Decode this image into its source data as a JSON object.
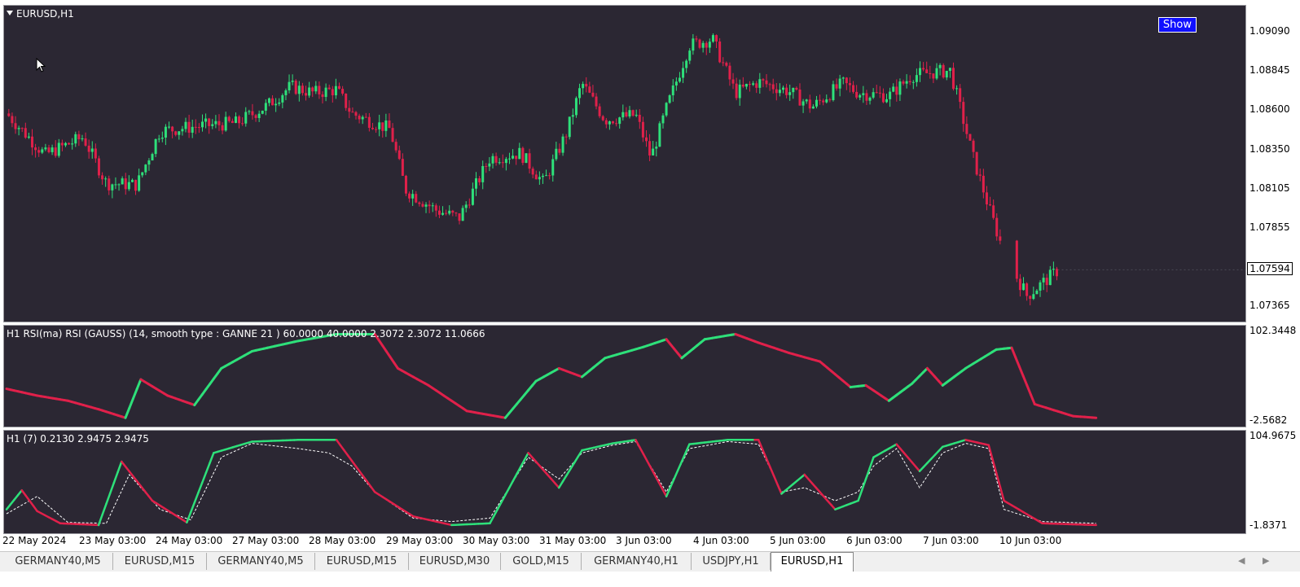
{
  "main": {
    "title": "EURUSD,H1",
    "show_button": "Show",
    "price_ticks": [
      "1.09090",
      "1.08845",
      "1.08600",
      "1.08350",
      "1.08105",
      "1.07855",
      "1.07365"
    ],
    "current_price": "1.07594",
    "colors": {
      "background": "#2b2733",
      "bull": "#2ee07a",
      "bear": "#e0204a"
    }
  },
  "rsi_pane": {
    "title": "H1 RSI(ma) RSI (GAUSS) (14, smooth type : GANNE  21 ) 60.0000 40.0000 2.3072 2.3072 11.0666",
    "ticks": [
      "102.3448",
      "-2.5682"
    ],
    "level_hint": "0.00"
  },
  "osc_pane": {
    "title": "H1  (7) 0.2130 2.9475 2.9475",
    "ticks": [
      "104.9675",
      "-1.8371"
    ],
    "level_hint": "0.00"
  },
  "time_axis": [
    "22 May 2024",
    "23 May 03:00",
    "24 May 03:00",
    "27 May 03:00",
    "28 May 03:00",
    "29 May 03:00",
    "30 May 03:00",
    "31 May 03:00",
    "3 Jun 03:00",
    "4 Jun 03:00",
    "5 Jun 03:00",
    "6 Jun 03:00",
    "7 Jun 03:00",
    "10 Jun 03:00"
  ],
  "tabs": [
    {
      "label": "GERMANY40,M5",
      "active": false
    },
    {
      "label": "EURUSD,M15",
      "active": false
    },
    {
      "label": "GERMANY40,M5",
      "active": false
    },
    {
      "label": "EURUSD,M15",
      "active": false
    },
    {
      "label": "EURUSD,M30",
      "active": false
    },
    {
      "label": "GOLD,M15",
      "active": false
    },
    {
      "label": "GERMANY40,H1",
      "active": false
    },
    {
      "label": "USDJPY,H1",
      "active": false
    },
    {
      "label": "EURUSD,H1",
      "active": true
    }
  ],
  "chart_data": [
    {
      "type": "candlestick",
      "title": "EURUSD,H1",
      "ylim": [
        1.0725,
        1.0917
      ],
      "x": [
        "22 May 2024",
        "23 May 03:00",
        "24 May 03:00",
        "27 May 03:00",
        "28 May 03:00",
        "29 May 03:00",
        "30 May 03:00",
        "31 May 03:00",
        "3 Jun 03:00",
        "4 Jun 03:00",
        "5 Jun 03:00",
        "6 Jun 03:00",
        "7 Jun 03:00",
        "10 Jun 03:00"
      ],
      "close_path": [
        [
          0,
          1.0858
        ],
        [
          0.5,
          1.0832
        ],
        [
          1,
          1.0843
        ],
        [
          1.3,
          1.0814
        ],
        [
          1.7,
          1.0813
        ],
        [
          2,
          1.0847
        ],
        [
          2.5,
          1.085
        ],
        [
          3,
          1.0852
        ],
        [
          3.4,
          1.0863
        ],
        [
          3.7,
          1.0875
        ],
        [
          4,
          1.0871
        ],
        [
          4.3,
          1.0873
        ],
        [
          4.5,
          1.0858
        ],
        [
          5,
          1.0848
        ],
        [
          5.2,
          1.081
        ],
        [
          5.6,
          1.0797
        ],
        [
          5.9,
          1.0792
        ],
        [
          6.3,
          1.083
        ],
        [
          6.7,
          1.0833
        ],
        [
          7,
          1.0814
        ],
        [
          7.3,
          1.0846
        ],
        [
          7.5,
          1.0877
        ],
        [
          7.8,
          1.0854
        ],
        [
          8.2,
          1.0857
        ],
        [
          8.4,
          1.083
        ],
        [
          8.6,
          1.0861
        ],
        [
          8.9,
          1.0901
        ],
        [
          9.2,
          1.0905
        ],
        [
          9.5,
          1.0871
        ],
        [
          9.8,
          1.0878
        ],
        [
          10.2,
          1.0872
        ],
        [
          10.5,
          1.0862
        ],
        [
          10.9,
          1.0877
        ],
        [
          11.1,
          1.0871
        ],
        [
          11.5,
          1.0869
        ],
        [
          11.8,
          1.0882
        ],
        [
          12.1,
          1.0884
        ],
        [
          12.3,
          1.0885
        ],
        [
          12.6,
          1.083
        ],
        [
          12.8,
          1.0799
        ],
        [
          13.0,
          1.077
        ],
        [
          13.3,
          1.0743
        ],
        [
          13.7,
          1.0759
        ]
      ],
      "last_close": 1.07594
    },
    {
      "type": "line",
      "title": "H1 RSI(ma) RSI (GAUSS) (14, smooth type : GANNE  21 ) 60.0000 40.0000 2.3072 2.3072 11.0666",
      "ylim": [
        -2.5682,
        102.3448
      ],
      "series": [
        {
          "values": [
            [
              0,
              36
            ],
            [
              0.4,
              28
            ],
            [
              0.8,
              22
            ],
            [
              1.2,
              12
            ],
            [
              1.55,
              2
            ],
            [
              1.75,
              47
            ],
            [
              2.1,
              28
            ],
            [
              2.45,
              17
            ],
            [
              2.8,
              60
            ],
            [
              3.2,
              80
            ],
            [
              3.8,
              92
            ],
            [
              4.3,
              100
            ],
            [
              4.8,
              100
            ],
            [
              5.1,
              60
            ],
            [
              5.5,
              40
            ],
            [
              6.0,
              10
            ],
            [
              6.5,
              2
            ],
            [
              6.9,
              45
            ],
            [
              7.2,
              60
            ],
            [
              7.5,
              50
            ],
            [
              7.8,
              72
            ],
            [
              8.3,
              85
            ],
            [
              8.6,
              94
            ],
            [
              8.8,
              72
            ],
            [
              9.1,
              94
            ],
            [
              9.5,
              100
            ],
            [
              9.8,
              90
            ],
            [
              10.2,
              78
            ],
            [
              10.6,
              68
            ],
            [
              11.0,
              38
            ],
            [
              11.2,
              40
            ],
            [
              11.5,
              22
            ],
            [
              11.8,
              42
            ],
            [
              12.0,
              60
            ],
            [
              12.2,
              40
            ],
            [
              12.5,
              60
            ],
            [
              12.9,
              82
            ],
            [
              13.1,
              84
            ],
            [
              13.4,
              18
            ],
            [
              13.9,
              4
            ],
            [
              14.2,
              2
            ]
          ]
        }
      ]
    },
    {
      "type": "line",
      "title": "H1  (7) 0.2130 2.9475 2.9475",
      "ylim": [
        -1.8371,
        104.9675
      ],
      "series": [
        {
          "values": [
            [
              0,
              20
            ],
            [
              0.2,
              42
            ],
            [
              0.4,
              18
            ],
            [
              0.7,
              4
            ],
            [
              1.2,
              2
            ],
            [
              1.5,
              75
            ],
            [
              1.9,
              30
            ],
            [
              2.35,
              5
            ],
            [
              2.7,
              85
            ],
            [
              3.2,
              98
            ],
            [
              3.8,
              100
            ],
            [
              4.3,
              100
            ],
            [
              4.8,
              40
            ],
            [
              5.3,
              12
            ],
            [
              5.8,
              2
            ],
            [
              6.3,
              4
            ],
            [
              6.8,
              85
            ],
            [
              7.2,
              45
            ],
            [
              7.5,
              88
            ],
            [
              7.9,
              96
            ],
            [
              8.2,
              100
            ],
            [
              8.6,
              35
            ],
            [
              8.9,
              95
            ],
            [
              9.4,
              100
            ],
            [
              9.8,
              100
            ],
            [
              10.1,
              38
            ],
            [
              10.4,
              60
            ],
            [
              10.8,
              20
            ],
            [
              11.1,
              30
            ],
            [
              11.3,
              80
            ],
            [
              11.6,
              95
            ],
            [
              11.9,
              64
            ],
            [
              12.2,
              92
            ],
            [
              12.5,
              100
            ],
            [
              12.8,
              94
            ],
            [
              13.0,
              30
            ],
            [
              13.5,
              4
            ],
            [
              14.2,
              2
            ]
          ]
        },
        {
          "values": [
            [
              0,
              15
            ],
            [
              0.4,
              35
            ],
            [
              0.8,
              5
            ],
            [
              1.3,
              4
            ],
            [
              1.6,
              60
            ],
            [
              2.0,
              20
            ],
            [
              2.4,
              8
            ],
            [
              2.8,
              80
            ],
            [
              3.2,
              96
            ],
            [
              3.8,
              90
            ],
            [
              4.2,
              85
            ],
            [
              4.5,
              70
            ],
            [
              4.8,
              40
            ],
            [
              5.3,
              10
            ],
            [
              5.8,
              6
            ],
            [
              6.3,
              10
            ],
            [
              6.8,
              80
            ],
            [
              7.2,
              55
            ],
            [
              7.5,
              85
            ],
            [
              7.9,
              94
            ],
            [
              8.2,
              98
            ],
            [
              8.6,
              40
            ],
            [
              8.9,
              90
            ],
            [
              9.4,
              98
            ],
            [
              9.8,
              95
            ],
            [
              10.1,
              40
            ],
            [
              10.4,
              45
            ],
            [
              10.8,
              30
            ],
            [
              11.1,
              40
            ],
            [
              11.3,
              70
            ],
            [
              11.6,
              90
            ],
            [
              11.9,
              45
            ],
            [
              12.2,
              85
            ],
            [
              12.5,
              96
            ],
            [
              12.8,
              90
            ],
            [
              13.0,
              20
            ],
            [
              13.5,
              6
            ],
            [
              14.2,
              4
            ]
          ]
        }
      ]
    }
  ]
}
